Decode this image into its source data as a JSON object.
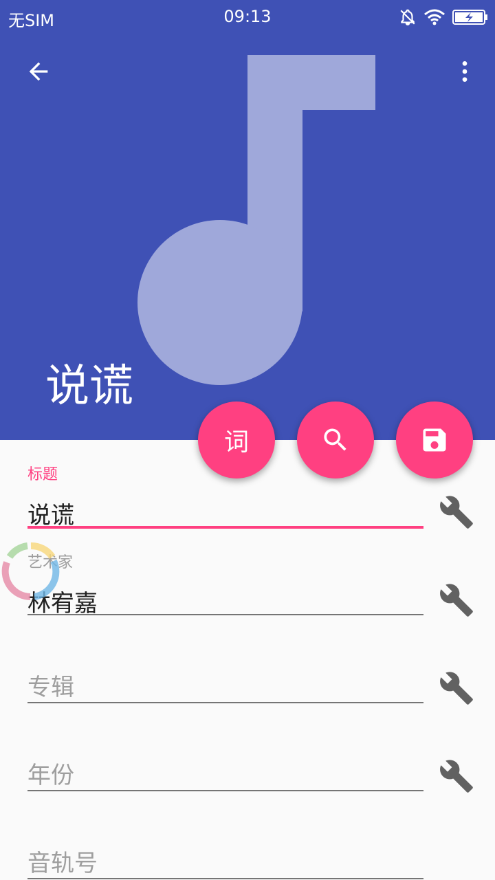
{
  "status_bar": {
    "carrier": "无SIM",
    "time": "09:13"
  },
  "header": {
    "title": "说谎",
    "background": "#3f51b5",
    "art_color": "#9fa8da"
  },
  "fabs": {
    "lyrics_label": "词"
  },
  "form": {
    "title": {
      "label": "标题",
      "value": "说谎"
    },
    "artist": {
      "label": "艺术家",
      "value": "林宥嘉"
    },
    "album": {
      "placeholder": "专辑"
    },
    "year": {
      "placeholder": "年份"
    },
    "track": {
      "placeholder": "音轨号"
    }
  },
  "colors": {
    "accent": "#ff4081",
    "primary": "#3f51b5",
    "wrench": "#616161"
  },
  "icons": [
    "back-arrow-icon",
    "more-vert-icon",
    "bell-off-icon",
    "wifi-icon",
    "battery-charging-icon",
    "search-icon",
    "save-icon",
    "wrench-icon"
  ]
}
